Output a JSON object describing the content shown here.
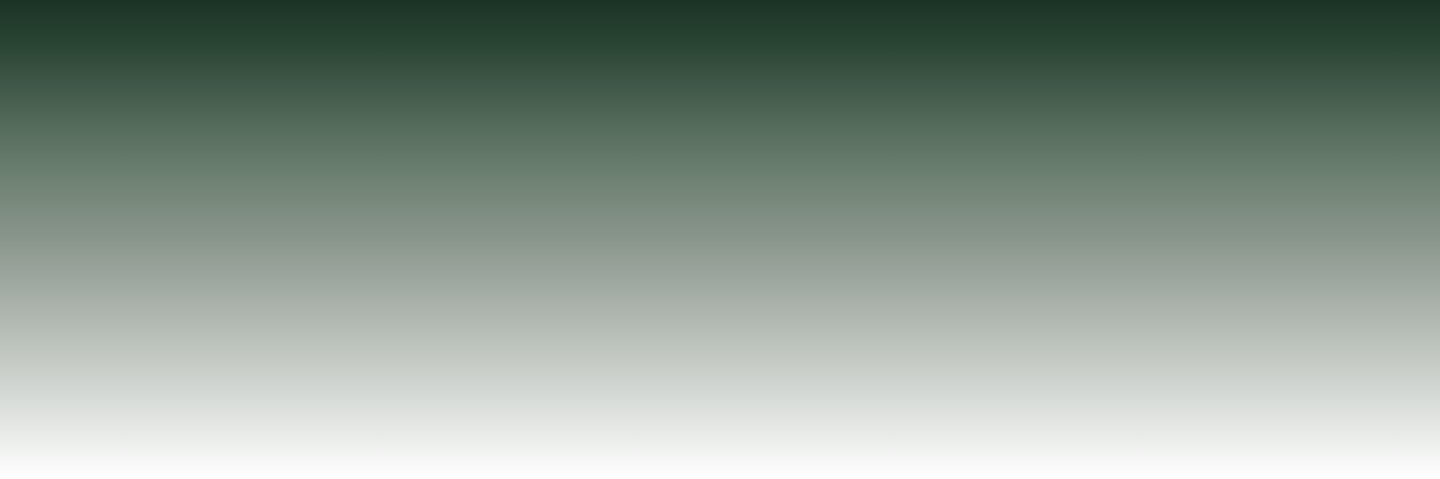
{
  "page": {
    "background": {
      "type": "vertical-gradient",
      "top_color": "#1a3324",
      "bottom_color": "#ffffff"
    }
  }
}
